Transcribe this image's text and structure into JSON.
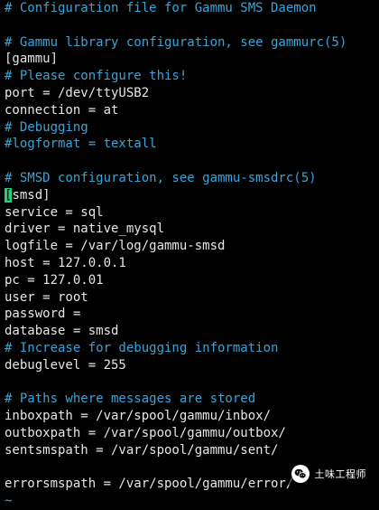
{
  "editor": {
    "lines": [
      {
        "text": "# Configuration file for Gammu SMS Daemon",
        "kind": "comment"
      },
      {
        "text": "",
        "kind": "plain"
      },
      {
        "text": "# Gammu library configuration, see gammurc(5)",
        "kind": "comment"
      },
      {
        "text": "[gammu]",
        "kind": "plain"
      },
      {
        "text": "# Please configure this!",
        "kind": "comment"
      },
      {
        "text": "port = /dev/ttyUSB2",
        "kind": "plain"
      },
      {
        "text": "connection = at",
        "kind": "plain"
      },
      {
        "text": "# Debugging",
        "kind": "comment"
      },
      {
        "text": "#logformat = textall",
        "kind": "comment"
      },
      {
        "text": "",
        "kind": "plain"
      },
      {
        "text": "# SMSD configuration, see gammu-smsdrc(5)",
        "kind": "comment"
      },
      {
        "text": "[smsd]",
        "kind": "plain",
        "cursor": true
      },
      {
        "text": "service = sql",
        "kind": "plain"
      },
      {
        "text": "driver = native_mysql",
        "kind": "plain"
      },
      {
        "text": "logfile = /var/log/gammu-smsd",
        "kind": "plain"
      },
      {
        "text": "host = 127.0.0.1",
        "kind": "plain"
      },
      {
        "text": "pc = 127.0.01",
        "kind": "plain"
      },
      {
        "text": "user = root",
        "kind": "plain"
      },
      {
        "text": "password =",
        "kind": "plain"
      },
      {
        "text": "database = smsd",
        "kind": "plain"
      },
      {
        "text": "# Increase for debugging information",
        "kind": "comment"
      },
      {
        "text": "debuglevel = 255",
        "kind": "plain"
      },
      {
        "text": "",
        "kind": "plain"
      },
      {
        "text": "# Paths where messages are stored",
        "kind": "comment"
      },
      {
        "text": "inboxpath = /var/spool/gammu/inbox/",
        "kind": "plain"
      },
      {
        "text": "outboxpath = /var/spool/gammu/outbox/",
        "kind": "plain"
      },
      {
        "text": "sentsmspath = /var/spool/gammu/sent/",
        "kind": "plain"
      },
      {
        "text": "",
        "kind": "plain"
      },
      {
        "text": "errorsmspath = /var/spool/gammu/error/",
        "kind": "plain"
      },
      {
        "text": "~",
        "kind": "tilde"
      }
    ]
  },
  "watermark": {
    "label": "土味工程师",
    "icon": "wechat-icon"
  },
  "colors": {
    "background": "#000000",
    "text": "#e6e6e6",
    "comment": "#3aa4d8",
    "cursor": "#21d07a"
  }
}
